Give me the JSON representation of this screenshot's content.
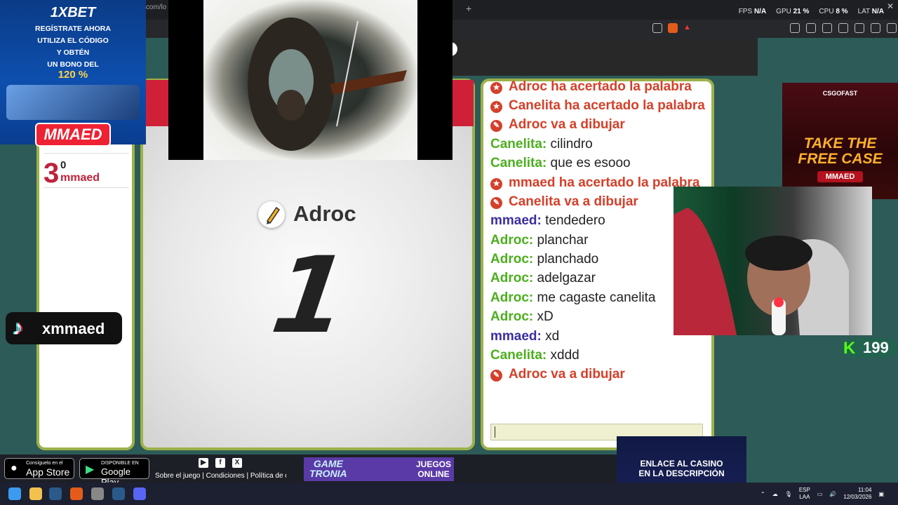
{
  "browser": {
    "url": "k.com/lo",
    "new_tab": "+",
    "stats": [
      {
        "label": "FPS",
        "value": "N/A"
      },
      {
        "label": "GPU",
        "value": "21 %"
      },
      {
        "label": "CPU",
        "value": "8 %"
      },
      {
        "label": "LAT",
        "value": "N/A"
      }
    ],
    "close": "✕"
  },
  "scoreboard": {
    "rank": "3",
    "points": "0",
    "player": "mmaed"
  },
  "drawer": {
    "name": "Adroc",
    "countdown": "1"
  },
  "chat": {
    "lines": [
      {
        "kind": "correct",
        "text": "Adroc ha acertado la palabra"
      },
      {
        "kind": "correct",
        "text": "Canelita ha acertado la palabra"
      },
      {
        "kind": "draw",
        "text": "Adroc va a dibujar"
      },
      {
        "kind": "msg",
        "user": "Canelita:",
        "color": "#4caf1e",
        "text": "cilindro"
      },
      {
        "kind": "msg",
        "user": "Canelita:",
        "color": "#4caf1e",
        "text": "que es esooo"
      },
      {
        "kind": "correct",
        "text": "mmaed ha acertado la palabra"
      },
      {
        "kind": "draw",
        "text": "Canelita va a dibujar"
      },
      {
        "kind": "msg",
        "user": "mmaed:",
        "color": "#3b2f9e",
        "text": "tendedero"
      },
      {
        "kind": "msg",
        "user": "Adroc:",
        "color": "#4caf1e",
        "text": "planchar"
      },
      {
        "kind": "msg",
        "user": "Adroc:",
        "color": "#4caf1e",
        "text": "planchado"
      },
      {
        "kind": "msg",
        "user": "Adroc:",
        "color": "#4caf1e",
        "text": "adelgazar"
      },
      {
        "kind": "msg",
        "user": "Adroc:",
        "color": "#4caf1e",
        "text": "me cagaste canelita"
      },
      {
        "kind": "msg",
        "user": "Adroc:",
        "color": "#4caf1e",
        "text": "xD"
      },
      {
        "kind": "msg",
        "user": "mmaed:",
        "color": "#3b2f9e",
        "text": "xd"
      },
      {
        "kind": "msg",
        "user": "Canelita:",
        "color": "#4caf1e",
        "text": "xddd"
      },
      {
        "kind": "draw",
        "text": "Adroc va a dibujar"
      }
    ],
    "input_value": ""
  },
  "ads": {
    "xbet": {
      "brand": "1XBET",
      "line1": "REGÍSTRATE AHORA",
      "line2": "UTILIZA EL CÓDIGO",
      "line3": "Y OBTÉN",
      "line4": "UN BONO DEL",
      "bonus": "120 %",
      "code": "MMAED"
    },
    "tiktok": "xmmaed",
    "csgo": {
      "brand": "CSGOFAST",
      "line1": "TAKE THE",
      "line2": "FREE CASE",
      "code": "MMAED"
    },
    "kick_count": "199",
    "casino": {
      "line1": "ENLACE AL CASINO",
      "line2": "EN LA DESCRIPCIÓN"
    }
  },
  "footer": {
    "appstore_small": "Consíguelo en el",
    "appstore_big": "App Store",
    "gplay_small": "DISPONIBLE EN",
    "gplay_big": "Google Play",
    "links": "Sobre el juego | Condiciones | Política de dat",
    "gametronia_1": "GAME",
    "gametronia_2": "TRONIA",
    "juegos_1": "JUEGOS",
    "juegos_2": "ONLINE"
  },
  "taskbar": {
    "lang1": "ESP",
    "lang2": "LAA",
    "time": "11:04",
    "date": "12/03/2026"
  },
  "colors": {
    "panel_border": "#9db14a",
    "system_message": "#d4402a",
    "player_red": "#c0223b"
  }
}
